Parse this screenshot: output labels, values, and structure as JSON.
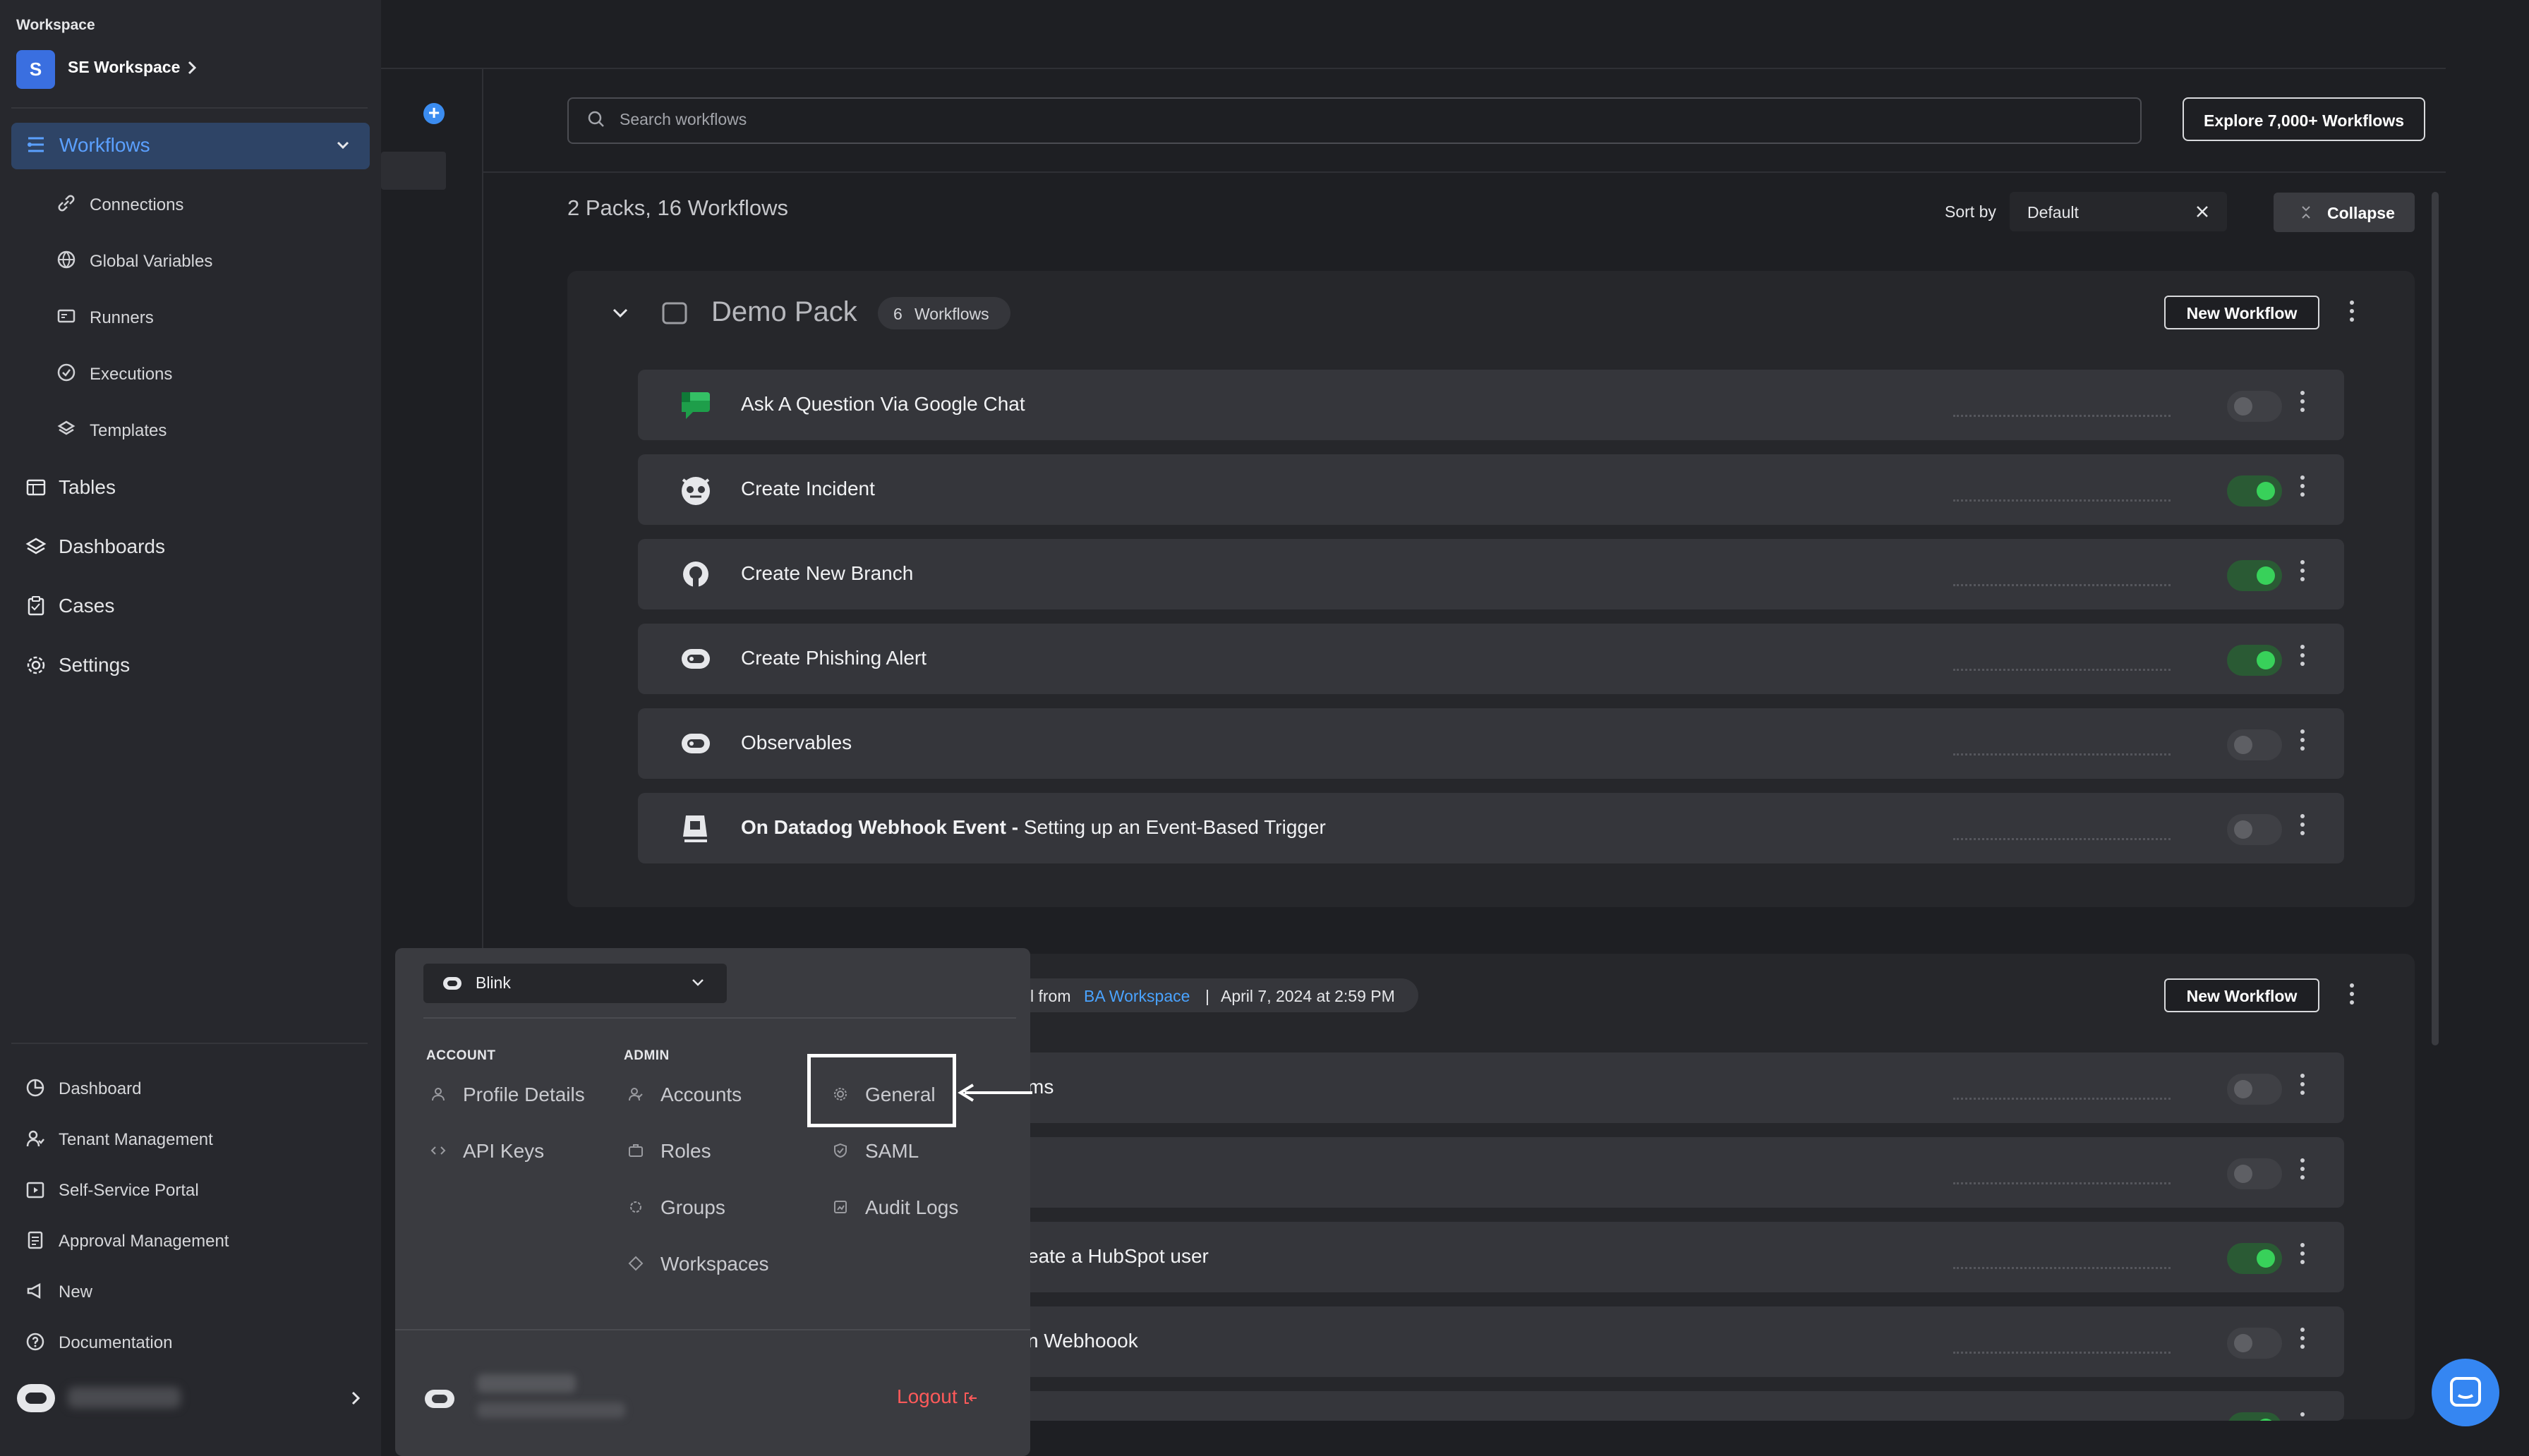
{
  "workspace": {
    "label": "Workspace",
    "avatar_letter": "S",
    "name": "SE Workspace"
  },
  "sidebar": {
    "main": [
      {
        "label": "Workflows",
        "icon": "workflows-icon",
        "active": true
      }
    ],
    "sub": [
      {
        "label": "Connections",
        "icon": "link-icon"
      },
      {
        "label": "Global Variables",
        "icon": "globe-icon"
      },
      {
        "label": "Runners",
        "icon": "runner-icon"
      },
      {
        "label": "Executions",
        "icon": "check-circle-icon"
      },
      {
        "label": "Templates",
        "icon": "templates-icon"
      }
    ],
    "sections": [
      {
        "label": "Tables",
        "icon": "table-icon"
      },
      {
        "label": "Dashboards",
        "icon": "layers-icon"
      },
      {
        "label": "Cases",
        "icon": "clipboard-icon"
      },
      {
        "label": "Settings",
        "icon": "gear-icon"
      }
    ],
    "bottom": [
      {
        "label": "Dashboard",
        "icon": "pie-icon"
      },
      {
        "label": "Tenant Management",
        "icon": "users-icon"
      },
      {
        "label": "Self-Service Portal",
        "icon": "portal-icon"
      },
      {
        "label": "Approval Management",
        "icon": "approval-icon"
      },
      {
        "label": "New",
        "icon": "megaphone-icon"
      },
      {
        "label": "Documentation",
        "icon": "help-icon"
      }
    ]
  },
  "search": {
    "placeholder": "Search workflows"
  },
  "explore_label": "Explore 7,000+ Workflows",
  "summary": "2 Packs, 16 Workflows",
  "sort": {
    "label": "Sort by",
    "value": "Default"
  },
  "collapse_label": "Collapse",
  "pack1": {
    "title": "Demo Pack",
    "count": "6",
    "count_suffix": "Workflows",
    "new_workflow": "New Workflow",
    "rows": [
      {
        "title": "Ask A Question Via Google Chat",
        "icon": "google-chat-icon",
        "enabled": false
      },
      {
        "title": "Create Incident",
        "icon": "pagerduty-icon",
        "enabled": true
      },
      {
        "title": "Create New Branch",
        "icon": "github-icon",
        "enabled": true
      },
      {
        "title": "Create Phishing Alert",
        "icon": "blink-icon",
        "enabled": true
      },
      {
        "title": "Observables",
        "icon": "blink-icon",
        "enabled": false
      },
      {
        "title_bold": "On Datadog Webhook Event -",
        "title_rest": " Setting up an Event-Based Trigger",
        "icon": "datadog-icon",
        "enabled": false
      }
    ]
  },
  "pack2": {
    "meta_from": "l from",
    "meta_ws": "BA Workspace",
    "meta_sep": "|",
    "meta_date": "April 7, 2024 at 2:59 PM",
    "new_workflow": "New Workflow",
    "rows": [
      {
        "title": "ms",
        "enabled": false
      },
      {
        "title": "",
        "enabled": false
      },
      {
        "title": "eate a HubSpot user",
        "enabled": true
      },
      {
        "title": "n Webhoook",
        "enabled": false
      },
      {
        "title": "",
        "enabled": true
      }
    ]
  },
  "popup": {
    "tenant": "Blink",
    "account_header": "ACCOUNT",
    "admin_header": "ADMIN",
    "account_items": [
      {
        "label": "Profile Details",
        "icon": "user-icon"
      },
      {
        "label": "API Keys",
        "icon": "code-icon"
      }
    ],
    "admin_items": [
      {
        "label": "Accounts",
        "icon": "users-icon"
      },
      {
        "label": "Roles",
        "icon": "briefcase-icon"
      },
      {
        "label": "Groups",
        "icon": "groups-icon"
      },
      {
        "label": "Workspaces",
        "icon": "diamond-icon"
      }
    ],
    "admin_items2": [
      {
        "label": "General",
        "icon": "settings-icon"
      },
      {
        "label": "SAML",
        "icon": "shield-icon"
      },
      {
        "label": "Audit Logs",
        "icon": "audit-icon"
      }
    ],
    "logout": "Logout"
  },
  "colors": {
    "accent": "#3b8cf0",
    "toggle_on": "#38d15a",
    "logout": "#ff5a5a",
    "link": "#4aa3ff"
  }
}
